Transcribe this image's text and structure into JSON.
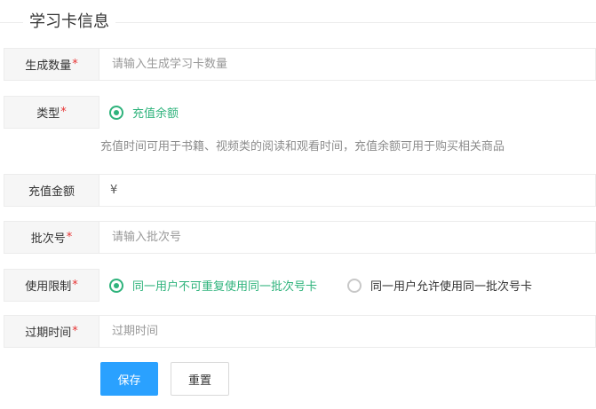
{
  "section": {
    "title": "学习卡信息"
  },
  "form": {
    "count": {
      "label": "生成数量",
      "required": "*",
      "placeholder": "请输入生成学习卡数量",
      "value": ""
    },
    "type": {
      "label": "类型",
      "required": "*",
      "option": "充值余额",
      "hint": "充值时间可用于书籍、视频类的阅读和观看时间，充值余额可用于购买相关商品"
    },
    "amount": {
      "label": "充值金额",
      "currency": "¥",
      "value": ""
    },
    "batch": {
      "label": "批次号",
      "required": "*",
      "placeholder": "请输入批次号",
      "value": ""
    },
    "limit": {
      "label": "使用限制",
      "required": "*",
      "options": [
        {
          "label": "同一用户不可重复使用同一批次号卡",
          "checked": true
        },
        {
          "label": "同一用户允许使用同一批次号卡",
          "checked": false
        }
      ]
    },
    "expiry": {
      "label": "过期时间",
      "required": "*",
      "placeholder": "过期时间",
      "value": ""
    }
  },
  "buttons": {
    "save": "保存",
    "reset": "重置"
  },
  "colors": {
    "primary": "#2aa1ff",
    "accent": "#2fb37c",
    "required": "#e63232"
  }
}
